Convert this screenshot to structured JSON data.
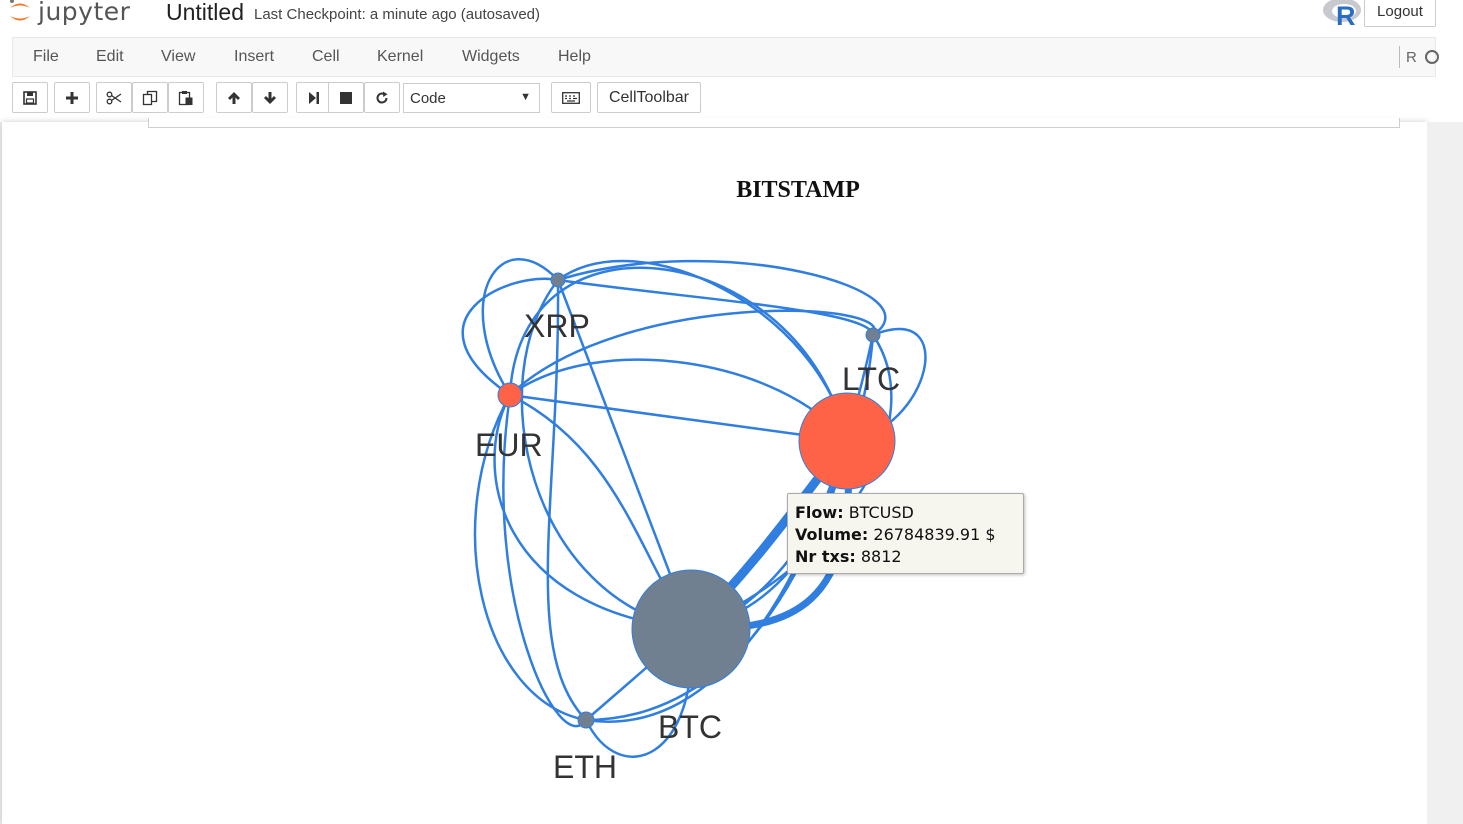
{
  "header": {
    "logo_text": "jupyter",
    "notebook_title": "Untitled",
    "checkpoint": "Last Checkpoint: a minute ago (autosaved)",
    "logout_label": "Logout",
    "r_logo_letter": "R"
  },
  "menu": {
    "items": [
      "File",
      "Edit",
      "View",
      "Insert",
      "Cell",
      "Kernel",
      "Widgets",
      "Help"
    ],
    "kernel_name": "R"
  },
  "toolbar": {
    "buttons": [
      "save-icon",
      "plus-icon",
      "cut-icon",
      "copy-icon",
      "paste-icon",
      "arrow-up-icon",
      "arrow-down-icon",
      "run-icon",
      "stop-icon",
      "restart-icon",
      "keyboard-icon"
    ],
    "cell_type": "Code",
    "celltoolbar_label": "CellToolbar"
  },
  "graph": {
    "title": "BITSTAMP",
    "nodes": [
      {
        "name": "XRP",
        "color": "#708090"
      },
      {
        "name": "LTC",
        "color": "#ff6347"
      },
      {
        "name": "EUR",
        "color": "#ff6347"
      },
      {
        "name": "BTC",
        "color": "#708090"
      },
      {
        "name": "ETH",
        "color": "#708090"
      }
    ],
    "edge_color": "#2f7ee0",
    "tooltip": {
      "flow_label": "Flow:",
      "flow_value": "BTCUSD",
      "volume_label": "Volume:",
      "volume_value": "26784839.91 $",
      "txs_label": "Nr txs:",
      "txs_value": "8812"
    }
  }
}
